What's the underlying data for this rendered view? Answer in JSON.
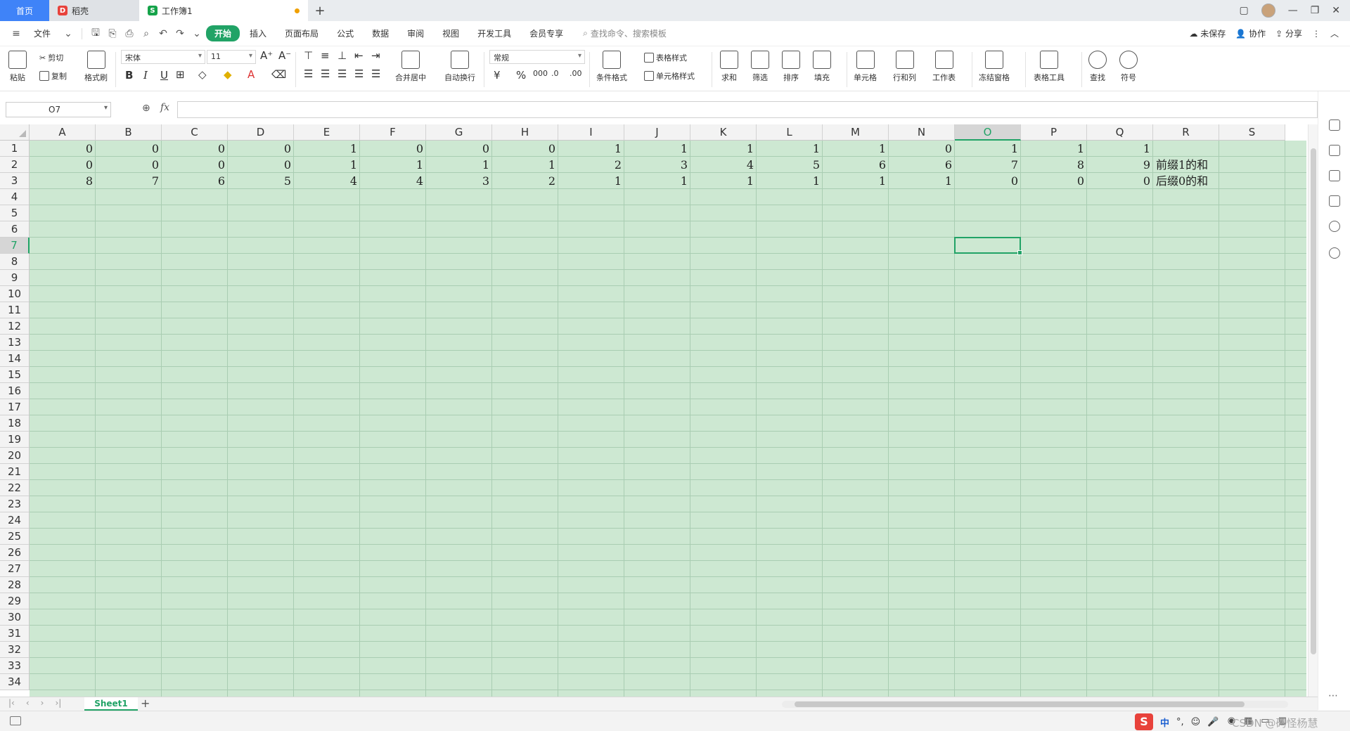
{
  "tabs": {
    "home": "首页",
    "doc1": "稻壳",
    "doc2": "工作簿1",
    "new": "+"
  },
  "menu": {
    "file": "文件",
    "items": [
      "开始",
      "插入",
      "页面布局",
      "公式",
      "数据",
      "审阅",
      "视图",
      "开发工具",
      "会员专享"
    ],
    "search_placeholder": "查找命令、搜索模板",
    "unsaved": "未保存",
    "collab": "协作",
    "share": "分享"
  },
  "ribbon": {
    "cut": "剪切",
    "copy": "复制",
    "paste": "粘贴",
    "format_painter": "格式刷",
    "font_name": "宋体",
    "font_size": "11",
    "merge_center": "合并居中",
    "wrap_text": "自动换行",
    "number_format": "常规",
    "conditional_format": "条件格式",
    "table_style": "表格样式",
    "cell_style": "单元格样式",
    "sum": "求和",
    "filter": "筛选",
    "sort": "排序",
    "fill": "填充",
    "cell": "单元格",
    "row_col": "行和列",
    "worksheet": "工作表",
    "freeze": "冻结窗格",
    "table_tools": "表格工具",
    "find": "查找",
    "symbol": "符号"
  },
  "formula_bar": {
    "name_box": "O7",
    "fx": "fx",
    "content": ""
  },
  "grid": {
    "columns": [
      "A",
      "B",
      "C",
      "D",
      "E",
      "F",
      "G",
      "H",
      "I",
      "J",
      "K",
      "L",
      "M",
      "N",
      "O",
      "P",
      "Q",
      "R",
      "S"
    ],
    "active_column": "O",
    "active_row": 7,
    "row_count": 34,
    "rows": [
      [
        "0",
        "0",
        "0",
        "0",
        "1",
        "0",
        "0",
        "0",
        "1",
        "1",
        "1",
        "1",
        "1",
        "0",
        "1",
        "1",
        "1"
      ],
      [
        "0",
        "0",
        "0",
        "0",
        "1",
        "1",
        "1",
        "1",
        "2",
        "3",
        "4",
        "5",
        "6",
        "6",
        "7",
        "8",
        "9"
      ],
      [
        "8",
        "7",
        "6",
        "5",
        "4",
        "4",
        "3",
        "2",
        "1",
        "1",
        "1",
        "1",
        "1",
        "1",
        "0",
        "0",
        "0"
      ]
    ],
    "labels": [
      "",
      "前缀1的和",
      "后缀0的和"
    ]
  },
  "sheets": {
    "active": "Sheet1",
    "add": "+"
  },
  "status": {
    "ime_lang": "中",
    "watermark": "CSDN @码怪杨慧"
  },
  "colors": {
    "accent": "#21a366",
    "grid_fill": "#cde8d2",
    "home_tab": "#3f83f8"
  }
}
